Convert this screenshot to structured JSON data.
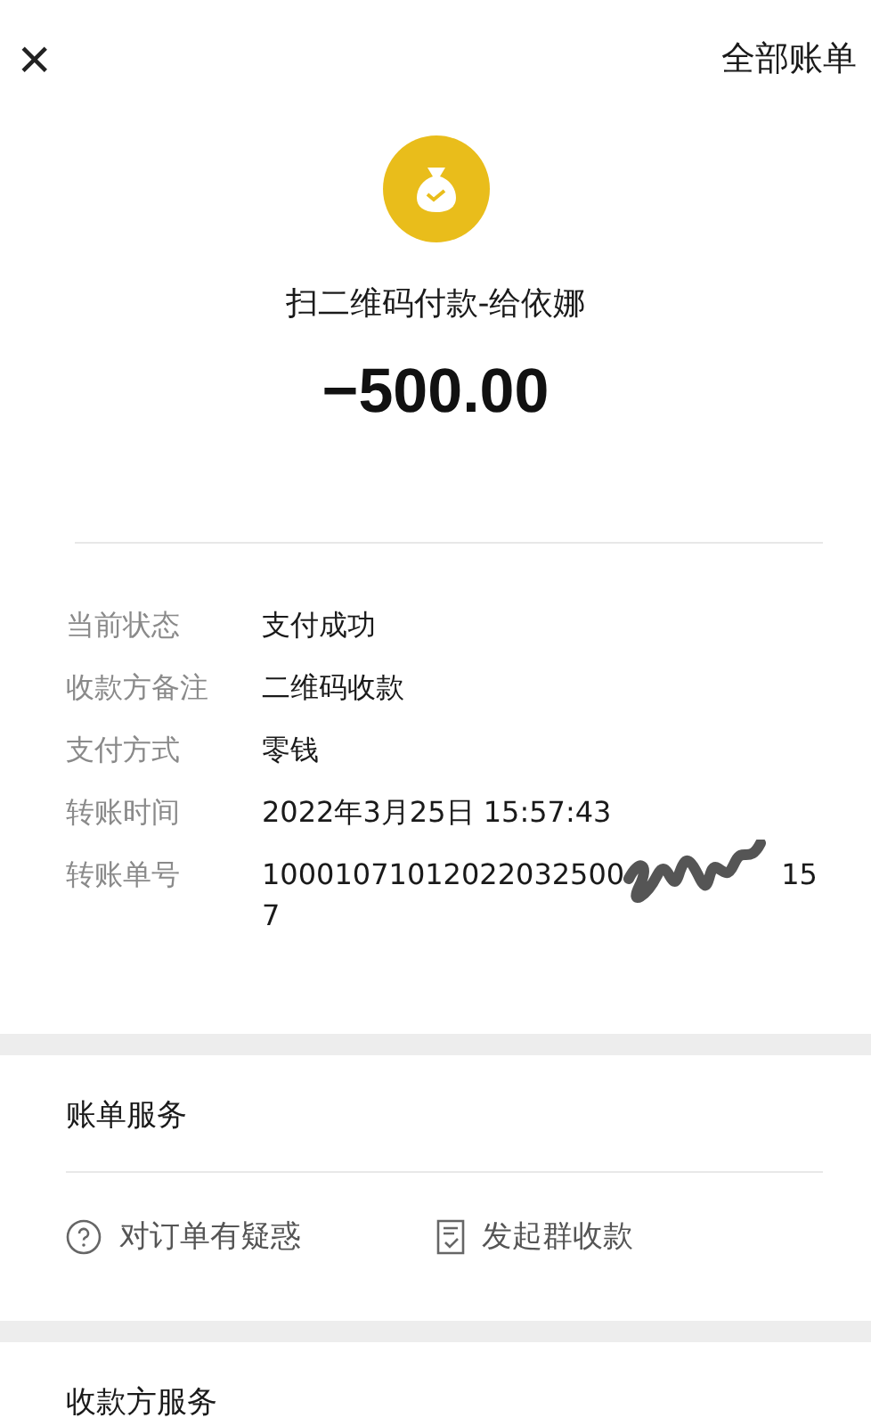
{
  "header": {
    "close": "×",
    "all_bills": "全部账单"
  },
  "payment": {
    "title": "扫二维码付款-给依娜",
    "amount": "−500.00"
  },
  "details": [
    {
      "label": "当前状态",
      "value": "支付成功"
    },
    {
      "label": "收款方备注",
      "value": "二维码收款"
    },
    {
      "label": "支付方式",
      "value": "零钱"
    },
    {
      "label": "转账时间",
      "value": "2022年3月25日 15:57:43"
    }
  ],
  "transfer_number": {
    "label": "转账单号",
    "visible_start": "10001071012022032500",
    "visible_end": "15",
    "second_line": "7",
    "redacted": true
  },
  "bill_service": {
    "title": "账单服务",
    "actions": [
      {
        "kind": "question",
        "label": "对订单有疑惑"
      },
      {
        "kind": "receipt",
        "label": "发起群收款"
      }
    ]
  },
  "payee_service": {
    "title": "收款方服务"
  }
}
